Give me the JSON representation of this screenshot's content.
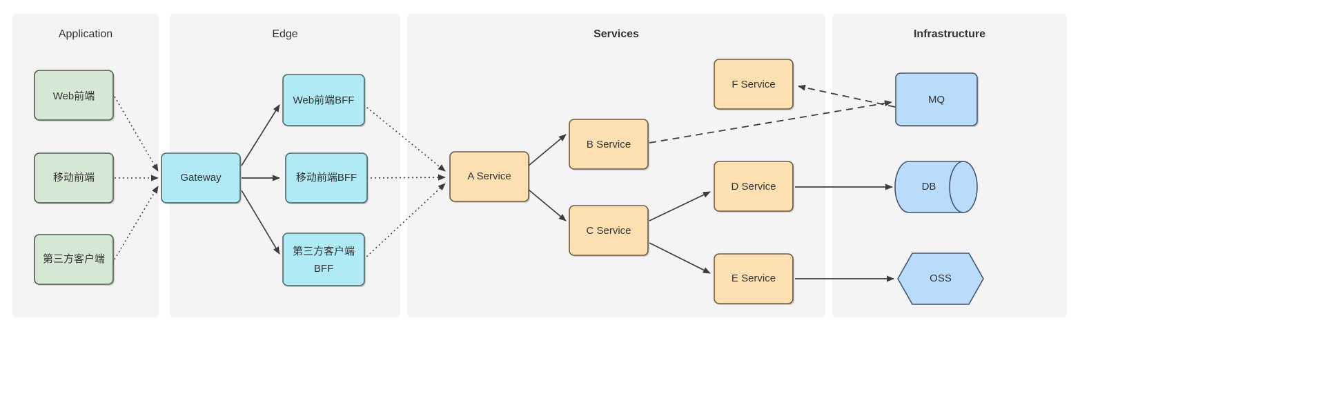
{
  "diagram": {
    "type": "layered-architecture",
    "background": "#ffffff",
    "cluster_background": "#f4f4f4",
    "palette": {
      "application_fill": "#d5e8d4",
      "application_stroke": "#4b5a4c",
      "edge_fill": "#b0ebf5",
      "edge_stroke": "#4b6469",
      "service_fill": "#fde0b2",
      "service_stroke": "#6b5a3e",
      "infrastructure_fill": "#b9dcfb",
      "infrastructure_stroke": "#44536b",
      "connector": "#3c3c3c",
      "text": "#333333"
    },
    "clusters": [
      {
        "id": "application",
        "title": "Application",
        "bold": false
      },
      {
        "id": "edge",
        "title": "Edge",
        "bold": false
      },
      {
        "id": "services",
        "title": "Services",
        "bold": true
      },
      {
        "id": "infrastructure",
        "title": "Infrastructure",
        "bold": true
      }
    ],
    "nodes": [
      {
        "id": "web_frontend",
        "label": "Web前端",
        "cluster": "application",
        "shape": "rounded-rect"
      },
      {
        "id": "mobile_frontend",
        "label": "移动前端",
        "cluster": "application",
        "shape": "rounded-rect"
      },
      {
        "id": "third_party",
        "label": "第三方客户端",
        "cluster": "application",
        "shape": "rounded-rect"
      },
      {
        "id": "gateway",
        "label": "Gateway",
        "cluster": "edge",
        "shape": "rounded-rect"
      },
      {
        "id": "web_bff",
        "label": "Web前端BFF",
        "cluster": "edge",
        "shape": "rounded-rect"
      },
      {
        "id": "mobile_bff",
        "label": "移动前端BFF",
        "cluster": "edge",
        "shape": "rounded-rect"
      },
      {
        "id": "third_party_bff",
        "label_line1": "第三方客户端",
        "label_line2": "BFF",
        "cluster": "edge",
        "shape": "rounded-rect"
      },
      {
        "id": "a_service",
        "label": "A Service",
        "cluster": "services",
        "shape": "rounded-rect"
      },
      {
        "id": "b_service",
        "label": "B Service",
        "cluster": "services",
        "shape": "rounded-rect"
      },
      {
        "id": "c_service",
        "label": "C Service",
        "cluster": "services",
        "shape": "rounded-rect"
      },
      {
        "id": "d_service",
        "label": "D Service",
        "cluster": "services",
        "shape": "rounded-rect"
      },
      {
        "id": "e_service",
        "label": "E Service",
        "cluster": "services",
        "shape": "rounded-rect"
      },
      {
        "id": "f_service",
        "label": "F Service",
        "cluster": "services",
        "shape": "rounded-rect"
      },
      {
        "id": "mq",
        "label": "MQ",
        "cluster": "infrastructure",
        "shape": "rounded-rect"
      },
      {
        "id": "db",
        "label": "DB",
        "cluster": "infrastructure",
        "shape": "cylinder"
      },
      {
        "id": "oss",
        "label": "OSS",
        "cluster": "infrastructure",
        "shape": "hexagon"
      }
    ],
    "edges": [
      {
        "from": "web_frontend",
        "to": "gateway",
        "style": "dotted"
      },
      {
        "from": "mobile_frontend",
        "to": "gateway",
        "style": "dotted"
      },
      {
        "from": "third_party",
        "to": "gateway",
        "style": "dotted"
      },
      {
        "from": "gateway",
        "to": "web_bff",
        "style": "solid"
      },
      {
        "from": "gateway",
        "to": "mobile_bff",
        "style": "solid"
      },
      {
        "from": "gateway",
        "to": "third_party_bff",
        "style": "solid"
      },
      {
        "from": "web_bff",
        "to": "a_service",
        "style": "dotted"
      },
      {
        "from": "mobile_bff",
        "to": "a_service",
        "style": "dotted"
      },
      {
        "from": "third_party_bff",
        "to": "a_service",
        "style": "dotted"
      },
      {
        "from": "a_service",
        "to": "b_service",
        "style": "solid"
      },
      {
        "from": "a_service",
        "to": "c_service",
        "style": "solid"
      },
      {
        "from": "b_service",
        "to": "mq",
        "style": "dashed"
      },
      {
        "from": "mq",
        "to": "f_service",
        "style": "dashed"
      },
      {
        "from": "c_service",
        "to": "d_service",
        "style": "solid"
      },
      {
        "from": "c_service",
        "to": "e_service",
        "style": "solid"
      },
      {
        "from": "d_service",
        "to": "db",
        "style": "solid"
      },
      {
        "from": "e_service",
        "to": "oss",
        "style": "solid"
      }
    ]
  }
}
